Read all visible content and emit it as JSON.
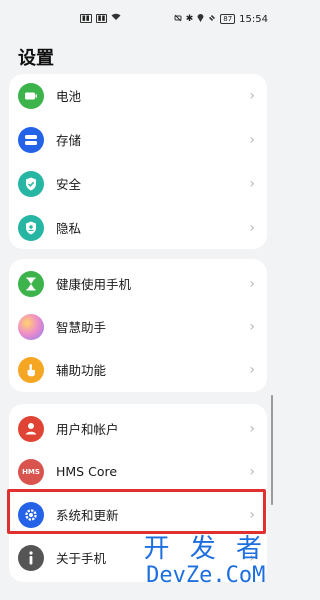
{
  "status_bar": {
    "left_icons": [
      "sim1-signal-icon",
      "sim2-signal-icon",
      "wifi-icon"
    ],
    "right_icons": [
      "silent-icon",
      "bluetooth-icon",
      "location-icon",
      "no-disturb-icon"
    ],
    "battery": "87",
    "time": "15:54"
  },
  "page": {
    "title": "设置"
  },
  "groups": [
    {
      "items": [
        {
          "label": "电池",
          "icon": "battery-icon",
          "color": "#3cb44b"
        },
        {
          "label": "存储",
          "icon": "storage-icon",
          "color": "#2463e8"
        },
        {
          "label": "安全",
          "icon": "shield-check-icon",
          "color": "#27b5a4"
        },
        {
          "label": "隐私",
          "icon": "privacy-shield-icon",
          "color": "#27b5a4"
        }
      ]
    },
    {
      "items": [
        {
          "label": "健康使用手机",
          "icon": "hourglass-icon",
          "color": "#3cb44b"
        },
        {
          "label": "智慧助手",
          "icon": "assistant-orb-icon",
          "color": "#d889d2"
        },
        {
          "label": "辅助功能",
          "icon": "hand-icon",
          "color": "#f5a623"
        }
      ]
    },
    {
      "items": [
        {
          "label": "用户和帐户",
          "icon": "user-icon",
          "color": "#e04434"
        },
        {
          "label": "HMS Core",
          "icon": "hms-icon",
          "color": "#d9534f",
          "icon_text": "HMS"
        },
        {
          "label": "系统和更新",
          "icon": "gear-icon",
          "color": "#2463e8"
        },
        {
          "label": "关于手机",
          "icon": "info-icon",
          "color": "#555555"
        }
      ]
    }
  ],
  "watermark": {
    "line1": "开 发 者",
    "line2": "DevZe.CoM"
  },
  "chevron": "›"
}
